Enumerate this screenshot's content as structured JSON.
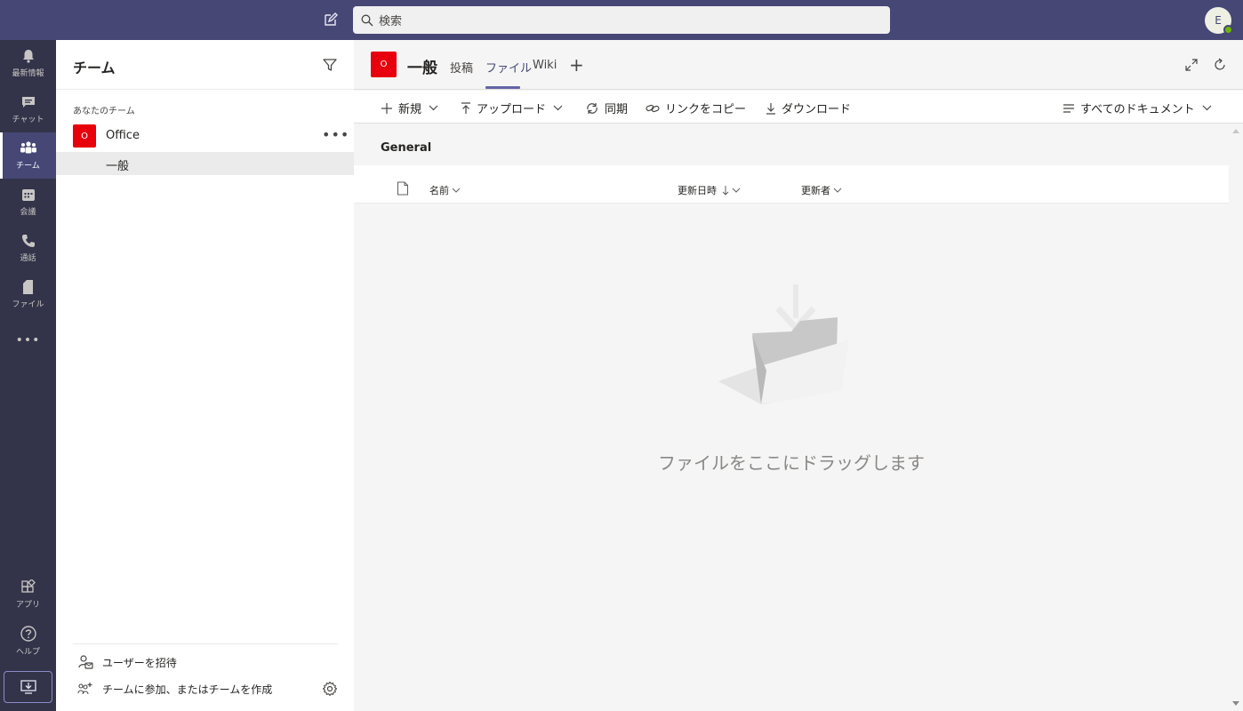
{
  "topbar": {
    "search_placeholder": "検索",
    "avatar_initial": "E",
    "colors": {
      "bar": "#464775",
      "presence": "#6bb700"
    }
  },
  "rail": {
    "items": [
      {
        "label": "最新情報",
        "icon": "bell-icon"
      },
      {
        "label": "チャット",
        "icon": "chat-icon"
      },
      {
        "label": "チーム",
        "icon": "teams-icon",
        "active": true
      },
      {
        "label": "会議",
        "icon": "calendar-icon"
      },
      {
        "label": "通話",
        "icon": "phone-icon"
      },
      {
        "label": "ファイル",
        "icon": "file-icon"
      }
    ],
    "more": "•••",
    "apps_label": "アプリ",
    "help_label": "ヘルプ"
  },
  "panel": {
    "title": "チーム",
    "section_label": "あなたのチーム",
    "team": {
      "initial": "O",
      "name": "Office",
      "more": "•••"
    },
    "channel": {
      "name": "一般"
    },
    "footer": {
      "invite": "ユーザーを招待",
      "join_create": "チームに参加、またはチームを作成"
    }
  },
  "main": {
    "channel_initial": "O",
    "channel_title": "一般",
    "tabs": [
      {
        "label": "投稿"
      },
      {
        "label": "ファイル",
        "active": true
      },
      {
        "label": "Wiki"
      }
    ],
    "tab_add": "+",
    "commands": {
      "new": "新規",
      "upload": "アップロード",
      "sync": "同期",
      "copy_link": "リンクをコピー",
      "download": "ダウンロード",
      "view": "すべてのドキュメント"
    },
    "library_title": "General",
    "columns": {
      "name": "名前",
      "modified": "更新日時",
      "modified_by": "更新者"
    },
    "empty_message": "ファイルをここにドラッグします",
    "colors": {
      "accent": "#6264a7",
      "team_tile": "#e8000d"
    }
  }
}
